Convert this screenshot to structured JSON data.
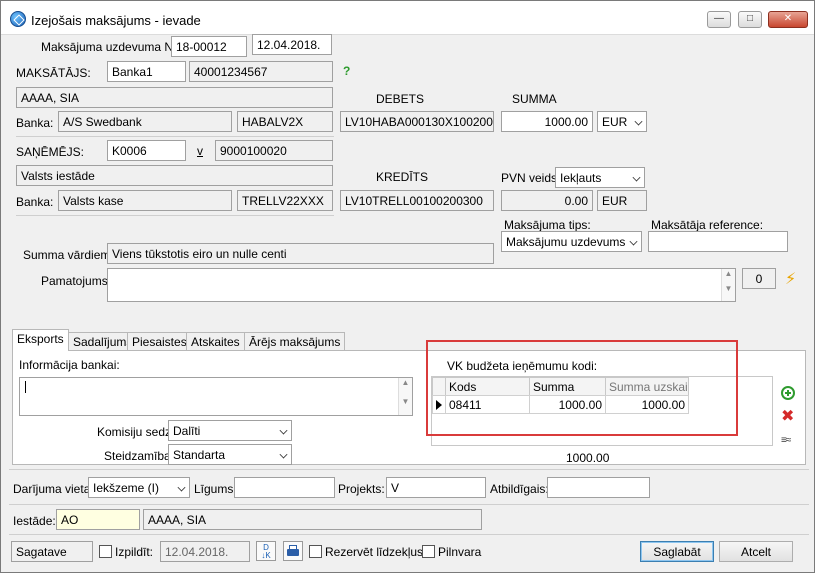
{
  "window": {
    "title": "Izejošais maksājums - ievade"
  },
  "header": {
    "order_no_label": "Maksājuma uzdevuma Nr.",
    "order_no": "18-00012",
    "date": "12.04.2018."
  },
  "payer": {
    "label": "MAKSĀTĀJS:",
    "code": "Banka1",
    "reg_no": "40001234567",
    "help": "?",
    "name": "AAAA, SIA",
    "bank_label": "Banka:",
    "bank": "A/S Swedbank",
    "swift": "HABALV2X",
    "debit_label": "DEBETS",
    "debit_account": "LV10HABA000130X100200"
  },
  "payee": {
    "label": "SAŅĒMĒJS:",
    "code": "K0006",
    "v_link": "v",
    "reg_no": "9000100020",
    "name": "Valsts iestāde",
    "bank_label": "Banka:",
    "bank": "Valsts kase",
    "swift": "TRELLV22XXX",
    "credit_label": "KREDĪTS",
    "credit_account": "LV10TRELL00100200300"
  },
  "amount": {
    "label": "SUMMA",
    "value": "1000.00",
    "currency": "EUR",
    "vat_label": "PVN veids:",
    "vat_type": "Iekļauts",
    "vat_value": "0.00",
    "vat_currency": "EUR"
  },
  "payment_type": {
    "label": "Maksājuma tips:",
    "value": "Maksājumu uzdevums"
  },
  "payer_ref": {
    "label": "Maksātāja reference:",
    "value": ""
  },
  "words": {
    "label": "Summa vārdiem:",
    "value": "Viens tūkstotis eiro un nulle centi"
  },
  "basis": {
    "label": "Pamatojums:",
    "counter": "0"
  },
  "tabs": [
    {
      "label": "Eksports"
    },
    {
      "label": "Sadalījums"
    },
    {
      "label": "Piesaistes"
    },
    {
      "label": "Atskaites"
    },
    {
      "label": "Ārējs maksājums"
    }
  ],
  "export": {
    "bank_info_label": "Informācija bankai:",
    "commission_label": "Komisiju sedz:",
    "commission": "Dalīti",
    "urgency_label": "Steidzamība:",
    "urgency": "Standarta"
  },
  "vk": {
    "title": "VK budžeta ieņēmumu kodi:",
    "columns": [
      "Kods",
      "Summa",
      "Summa uzskai..."
    ],
    "rows": [
      {
        "kods": "08411",
        "summa": "1000.00",
        "uzskaite": "1000.00"
      }
    ],
    "total": "1000.00"
  },
  "footer": {
    "deal_place_label": "Darījuma vieta:",
    "deal_place": "Iekšzeme (I)",
    "contract_label": "Līgums:",
    "contract": "",
    "project_label": "Projekts:",
    "project": "V",
    "responsible_label": "Atbildīgais:",
    "responsible": "",
    "institution_label": "Iestāde:",
    "institution_code": "AO",
    "institution_name": "AAAA, SIA",
    "status": "Sagatave",
    "execute_label": "Izpildīt:",
    "execute_date": "12.04.2018.",
    "reserve_label": "Rezervēt līdzekļus",
    "poa_label": "Pilnvara",
    "save": "Saglabāt",
    "cancel": "Atcelt"
  },
  "colors": {
    "accent": "#3c7fb1",
    "highlight_frame": "#d93b3b",
    "add": "#2e9b2e",
    "delete": "#d42a2a"
  }
}
